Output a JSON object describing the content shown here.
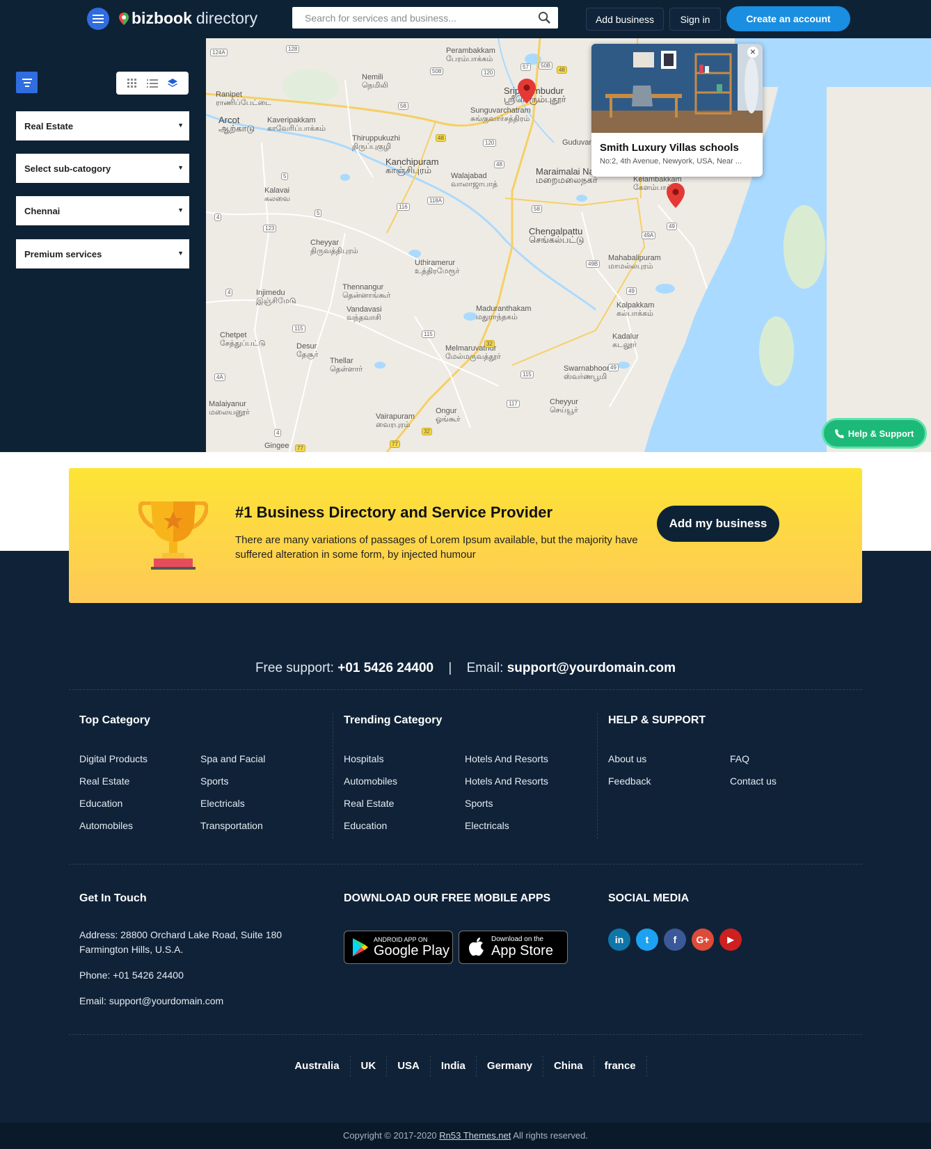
{
  "header": {
    "logo_bold": "bizbook",
    "logo_light": "directory",
    "search_placeholder": "Search for services and business...",
    "add_business": "Add business",
    "sign_in": "Sign in",
    "create_account": "Create an account"
  },
  "sidebar": {
    "selects": [
      "Real Estate",
      "Select sub-catogory",
      "Chennai",
      "Premium services"
    ]
  },
  "map": {
    "labels": [
      {
        "text": "Perambakkam",
        "tamil": "பேரம்பாக்கம்"
      },
      {
        "text": "Nemili",
        "tamil": "நெமிலி"
      },
      {
        "text": "Ranipet",
        "tamil": "ராணிப்பேட்டை"
      },
      {
        "text": "Arcot",
        "tamil": "ஆற்காடு"
      },
      {
        "text": "Kaveripakkam",
        "tamil": "காவேரிப்பாக்கம்"
      },
      {
        "text": "Sriperumbudur",
        "tamil": "ஸ்ரீபெரும்புதூர்"
      },
      {
        "text": "Sunguvarchatram",
        "tamil": "சுங்குவார்சத்திரம்"
      },
      {
        "text": "Thiruppukuzhi",
        "tamil": "திருப்புகுழி"
      },
      {
        "text": "Kanchipuram",
        "tamil": "காஞ்சிபுரம்"
      },
      {
        "text": "Walajabad",
        "tamil": "வாலாஜாபாத்"
      },
      {
        "text": "Maraimalai Nagar",
        "tamil": "மறைமலைநகர்"
      },
      {
        "text": "Kelambakkam",
        "tamil": "கேளம்பாக்கம்"
      },
      {
        "text": "Kalavai",
        "tamil": "கலவை"
      },
      {
        "text": "Chengalpattu",
        "tamil": "செங்கல்பட்டு"
      },
      {
        "text": "Cheyyar",
        "tamil": "திருவத்திபுரம்"
      },
      {
        "text": "Mahabalipuram",
        "tamil": "மாமல்லபுரம்"
      },
      {
        "text": "Uthiramerur",
        "tamil": "உத்திரமேரூர்"
      },
      {
        "text": "Thennangur",
        "tamil": "தென்னாங்கூர்"
      },
      {
        "text": "Injimedu",
        "tamil": "இஞ்சிமேடு"
      },
      {
        "text": "Kalpakkam",
        "tamil": "கல்பாக்கம்"
      },
      {
        "text": "Vandavasi",
        "tamil": "வந்தவாசி"
      },
      {
        "text": "Maduranthakam",
        "tamil": "மதுராந்தகம்"
      },
      {
        "text": "Chetpet",
        "tamil": "சேத்துப்பட்டு"
      },
      {
        "text": "Kadalur",
        "tamil": "கடலூர்"
      },
      {
        "text": "Desur",
        "tamil": "தேசூர்"
      },
      {
        "text": "Melmaruvathur",
        "tamil": "மேல்மருவத்தூர்"
      },
      {
        "text": "Thellar",
        "tamil": "தெள்ளார்"
      },
      {
        "text": "Swarnabhoomi",
        "tamil": "ஸ்வர்ணபூமி"
      },
      {
        "text": "Malaiyanur",
        "tamil": "மலையனூர்"
      },
      {
        "text": "Cheyyur",
        "tamil": "செய்யூர்"
      },
      {
        "text": "Ongur",
        "tamil": "ஓங்கூர்"
      },
      {
        "text": "Vairapuram",
        "tamil": "வைரபுரம்"
      },
      {
        "text": "Gingee",
        "tamil": ""
      },
      {
        "text": "Guduvanchery",
        "tamil": "குடுவாஞ்சேரி"
      }
    ],
    "shields": [
      "124A",
      "128",
      "508",
      "57",
      "50B",
      "48",
      "120",
      "58",
      "48",
      "120",
      "48",
      "5",
      "118A",
      "116",
      "58",
      "4",
      "123",
      "5",
      "49A",
      "49",
      "49B",
      "49",
      "4",
      "115",
      "115",
      "32",
      "115",
      "4A",
      "117",
      "49",
      "4",
      "32",
      "77",
      "77"
    ],
    "popup": {
      "title": "Smith Luxury Villas schools",
      "address": "No:2, 4th Avenue,  Newyork, USA, Near ..."
    },
    "help_support": "Help & Support"
  },
  "promo": {
    "title": "#1 Business Directory and Service Provider",
    "description": "There are many variations of passages of Lorem Ipsum available, but the majority have suffered alteration in some form, by injected humour",
    "button": "Add my business"
  },
  "footer": {
    "free_support_label": "Free support:",
    "phone": "+01 5426 24400",
    "sep": "|",
    "email_label": "Email:",
    "email": "support@yourdomain.com",
    "top_category": {
      "title": "Top Category",
      "links": [
        "Digital Products",
        "Spa and Facial",
        "Real Estate",
        "Sports",
        "Education",
        "Electricals",
        "Automobiles",
        "Transportation"
      ]
    },
    "trending_category": {
      "title": "Trending Category",
      "links": [
        "Hospitals",
        "Hotels And Resorts",
        "Automobiles",
        "Hotels And Resorts",
        "Real Estate",
        "Sports",
        "Education",
        "Electricals"
      ]
    },
    "help": {
      "title": "HELP & SUPPORT",
      "links": [
        "About us",
        "FAQ",
        "Feedback",
        "Contact us"
      ]
    },
    "get_in_touch": {
      "title": "Get In Touch",
      "address_line1": "Address: 28800 Orchard Lake Road, Suite 180",
      "address_line2": "Farmington Hills, U.S.A.",
      "phone": "Phone: +01 5426 24400",
      "email": "Email: support@yourdomain.com"
    },
    "apps": {
      "title": "DOWNLOAD OUR FREE MOBILE APPS",
      "google_small": "ANDROID APP ON",
      "google_big": "Google Play",
      "apple_small": "Download on the",
      "apple_big": "App Store"
    },
    "social": {
      "title": "SOCIAL MEDIA",
      "icons": [
        "linkedin-icon",
        "twitter-icon",
        "facebook-icon",
        "google-plus-icon",
        "youtube-icon"
      ],
      "labels": [
        "in",
        "t",
        "f",
        "G+",
        "▶"
      ],
      "colors": [
        "#0e76a8",
        "#1da1f2",
        "#3b5998",
        "#dd4b39",
        "#cd201f"
      ]
    },
    "countries": [
      "Australia",
      "UK",
      "USA",
      "India",
      "Germany",
      "China",
      "france"
    ],
    "copyright_prefix": "Copyright © 2017-2020 ",
    "copyright_link": "Rn53 Themes.net",
    "copyright_suffix": " All rights reserved."
  },
  "colors": {
    "navy": "#0e2236",
    "accent_blue": "#1a8ee0",
    "filter_blue": "#2f6de0",
    "help_green": "#1db978",
    "promo_yellow": "#fde435",
    "sea": "#aadaff"
  }
}
